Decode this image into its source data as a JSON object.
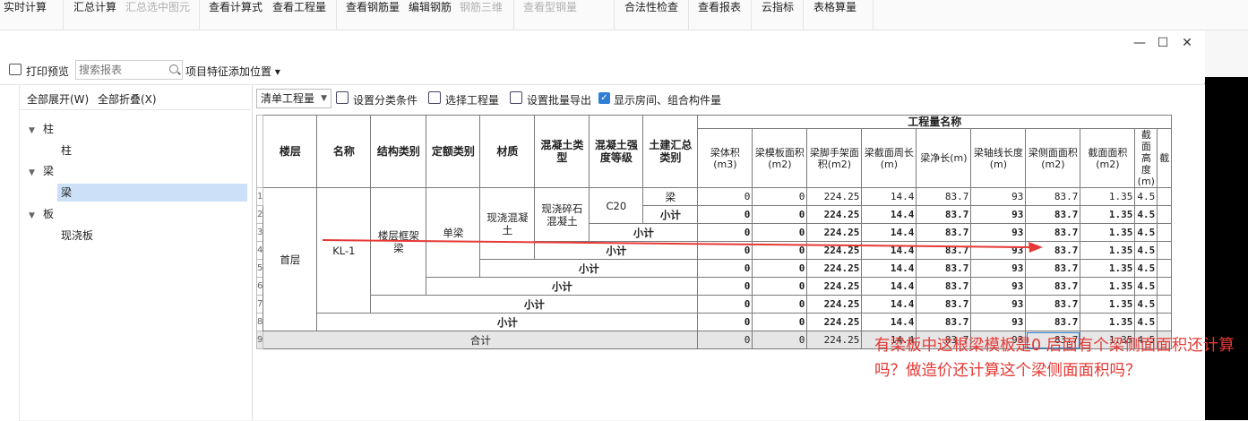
{
  "ribbon": {
    "items": [
      {
        "label": "实时计算",
        "disabled": false
      },
      {
        "label": "汇总计算",
        "disabled": false
      },
      {
        "label": "汇总选中图元",
        "disabled": true
      },
      {
        "label": "查看计算式",
        "disabled": false
      },
      {
        "label": "查看工程量",
        "disabled": false
      },
      {
        "label": "查看钢筋量",
        "disabled": false
      },
      {
        "label": "编辑钢筋",
        "disabled": false
      },
      {
        "label": "钢筋三维",
        "disabled": true
      },
      {
        "label": "查看型钢量",
        "disabled": true
      },
      {
        "label": "合法性检查",
        "disabled": false
      },
      {
        "label": "查看报表",
        "disabled": false
      },
      {
        "label": "云指标",
        "disabled": false
      },
      {
        "label": "表格算量",
        "disabled": false
      }
    ]
  },
  "window": {
    "minimize": "—",
    "maximize": "☐",
    "close": "✕"
  },
  "toolbar": {
    "print_label": "打印预览",
    "search_placeholder": "搜索报表",
    "feature_position": "项目特征添加位置 ▾"
  },
  "left_panel": {
    "expand_all": "全部展开(W)",
    "collapse_all": "全部折叠(X)",
    "tree": [
      {
        "label": "柱",
        "level": 0,
        "expanded": true
      },
      {
        "label": "柱",
        "level": 1
      },
      {
        "label": "梁",
        "level": 0,
        "expanded": true
      },
      {
        "label": "梁",
        "level": 1,
        "selected": true
      },
      {
        "label": "板",
        "level": 0,
        "expanded": true
      },
      {
        "label": "现浇板",
        "level": 1
      }
    ]
  },
  "main_toolbar": {
    "select_value": "清单工程量",
    "set_classification": "设置分类条件",
    "select_quantity": "选择工程量",
    "batch_export": "设置批量导出",
    "show_rooms_checked": true,
    "show_rooms": "显示房间、组合构件量"
  },
  "table": {
    "group_header": "工程量名称",
    "headers": [
      "楼层",
      "名称",
      "结构类别",
      "定额类别",
      "材质",
      "混凝土类型",
      "混凝土强度等级",
      "土建汇总类别"
    ],
    "quantity_headers": [
      "梁体积(m3)",
      "梁模板面积(m2)",
      "梁脚手架面积(m2)",
      "梁截面周长(m)",
      "梁净长(m)",
      "梁轴线长度(m)",
      "梁侧面面积(m2)",
      "截面面积(m2)",
      "截面高度(m)",
      "截"
    ],
    "row_numbers": [
      "1",
      "2",
      "3",
      "4",
      "5",
      "6",
      "7",
      "8",
      "9"
    ],
    "floor": "首层",
    "name": "KL-1",
    "struct_type": "楼层框架梁",
    "quota_type": "单梁",
    "material": "现浇混凝土",
    "concrete_type": "现浇碎石混凝土",
    "strength": "C20",
    "summary_type": "梁",
    "subtotal": "小计",
    "total": "合计",
    "values": [
      "0",
      "0",
      "224.25",
      "14.4",
      "83.7",
      "93",
      "83.7",
      "1.35",
      "4.5"
    ]
  },
  "annotation": {
    "text": "有梁板中这根梁模板是0  后面有个梁侧面面积还计算吗？做造价还计算这个梁侧面面积吗？",
    "color": "#e53935"
  }
}
